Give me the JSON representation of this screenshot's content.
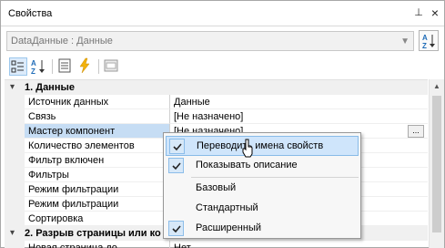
{
  "window": {
    "title": "Свойства",
    "pin_glyph": "⊥",
    "close_glyph": "×"
  },
  "object_selector": {
    "value": "DataДанные : Данные"
  },
  "grid": {
    "rows": [
      {
        "type": "category",
        "label": "1. Данные"
      },
      {
        "type": "property",
        "name": "Источник данных",
        "value": "Данные"
      },
      {
        "type": "property",
        "name": "Связь",
        "value": "[Не назначено]"
      },
      {
        "type": "property",
        "name": "Мастер компонент",
        "value": "[Не назначено]",
        "selected": true
      },
      {
        "type": "property",
        "name": "Количество элементов",
        "value": ""
      },
      {
        "type": "property",
        "name": "Фильтр включен",
        "value": ""
      },
      {
        "type": "property",
        "name": "Фильтры",
        "value": ""
      },
      {
        "type": "property",
        "name": "Режим фильтрации",
        "value": ""
      },
      {
        "type": "property",
        "name": "Режим фильтрации",
        "value": ""
      },
      {
        "type": "property",
        "name": "Сортировка",
        "value": ""
      },
      {
        "type": "category",
        "label": "2. Разрыв страницы или ко"
      },
      {
        "type": "property",
        "name": "Новая страница до",
        "value": "Нет"
      }
    ]
  },
  "context_menu": {
    "items": [
      {
        "label": "Переводить имена свойств",
        "checked": true,
        "hover": true
      },
      {
        "label": "Показывать описание",
        "checked": true,
        "hover": false
      },
      {
        "label": "Базовый",
        "checked": false,
        "hover": false
      },
      {
        "label": "Стандартный",
        "checked": false,
        "hover": false
      },
      {
        "label": "Расширенный",
        "checked": true,
        "hover": false
      }
    ]
  },
  "colors": {
    "selection": "#c6ddf4",
    "menu_hover": "#cfe5fb",
    "accent_blue": "#1f6cb8"
  }
}
